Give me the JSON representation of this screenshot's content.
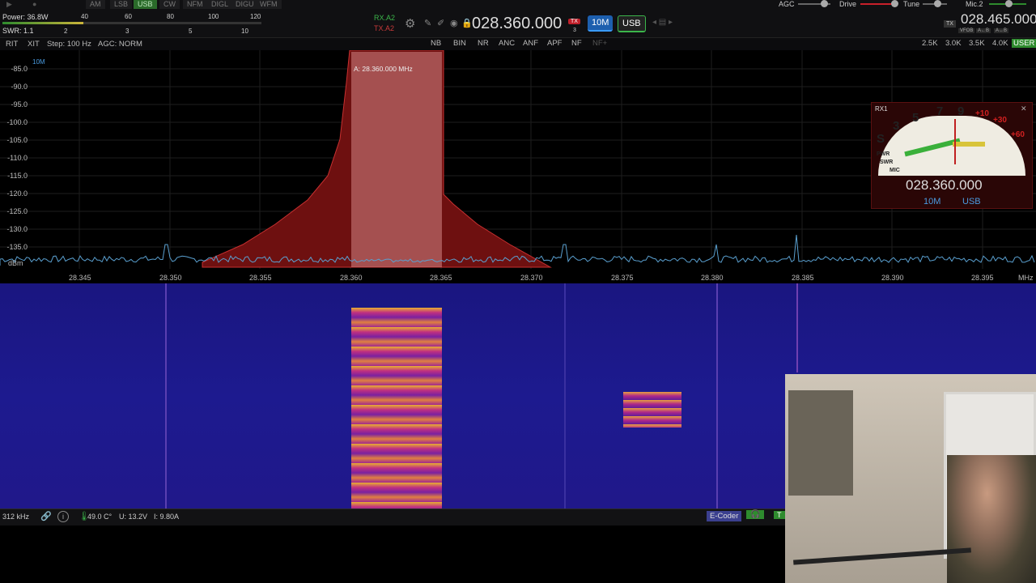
{
  "modes": [
    "AM",
    "LSB",
    "USB",
    "CW",
    "NFM",
    "DIGL",
    "DIGU",
    "WFM"
  ],
  "active_mode": "USB",
  "power_readout": "Power: 36.8W",
  "swr_readout": "SWR: 1.1",
  "power_scale": [
    "40",
    "60",
    "80",
    "100",
    "120"
  ],
  "swr_scale": [
    "2",
    "3",
    "5",
    "10"
  ],
  "rx_label": "RX.A2",
  "tx_label": "TX.A2",
  "vfo_a_freq": "028.360.000",
  "tx_badge": "TX",
  "tx_sub": "3",
  "band_button": "10M",
  "mode_button": "USB",
  "agc_label": "AGC",
  "drive_label": "Drive",
  "tune_label": "Tune",
  "mic_label": "Mic.2",
  "vfo_b_freq": "028.465.000",
  "vfo_b_badge": "TX",
  "vfo_b_tags": [
    "VFOB",
    "A←B",
    "A↔B"
  ],
  "sec": {
    "rit": "RIT",
    "xit": "XIT",
    "step": "Step: 100 Hz",
    "agc": "AGC: NORM",
    "dsp": [
      "NB",
      "BIN",
      "NR",
      "ANC",
      "ANF",
      "APF",
      "NF",
      "NF+"
    ],
    "filters": [
      "2.5K",
      "3.0K",
      "3.5K",
      "4.0K",
      "USER"
    ]
  },
  "band_tag": "10M",
  "dbm_unit": "dBm",
  "y_ticks": [
    "-85.0",
    "-90.0",
    "-95.0",
    "-100.0",
    "-105.0",
    "-110.0",
    "-115.0",
    "-120.0",
    "-125.0",
    "-130.0",
    "-135.0"
  ],
  "x_ticks": [
    "28.345",
    "28.350",
    "28.355",
    "28.360",
    "28.365",
    "28.370",
    "28.375",
    "28.380",
    "28.385",
    "28.390",
    "28.395"
  ],
  "x_unit": "MHz",
  "marker_label": "A: 28.360.000 MHz",
  "status": {
    "bandwidth": "312 kHz",
    "temp": "49.0 C°",
    "voltage": "U: 13.2V",
    "current": "I: 9.80A",
    "ecoder": "E-Coder",
    "extra": "T"
  },
  "smeter": {
    "rx": "RX1",
    "freq": "028.360.000",
    "band": "10M",
    "mode": "USB",
    "s_scale": [
      "S",
      "3",
      "5",
      "7",
      "9"
    ],
    "plus_scale": [
      "+10",
      "+30",
      "+60"
    ],
    "side_labels": [
      "PWR",
      "SWR",
      "MIC"
    ]
  },
  "colors": {
    "accent_green": "#2e8b2e",
    "spectrum_fill": "#7a1212",
    "passband": "#d98a8a",
    "waterfall_bg": "#1d1a8f",
    "band_blue": "#2a7fd4"
  }
}
